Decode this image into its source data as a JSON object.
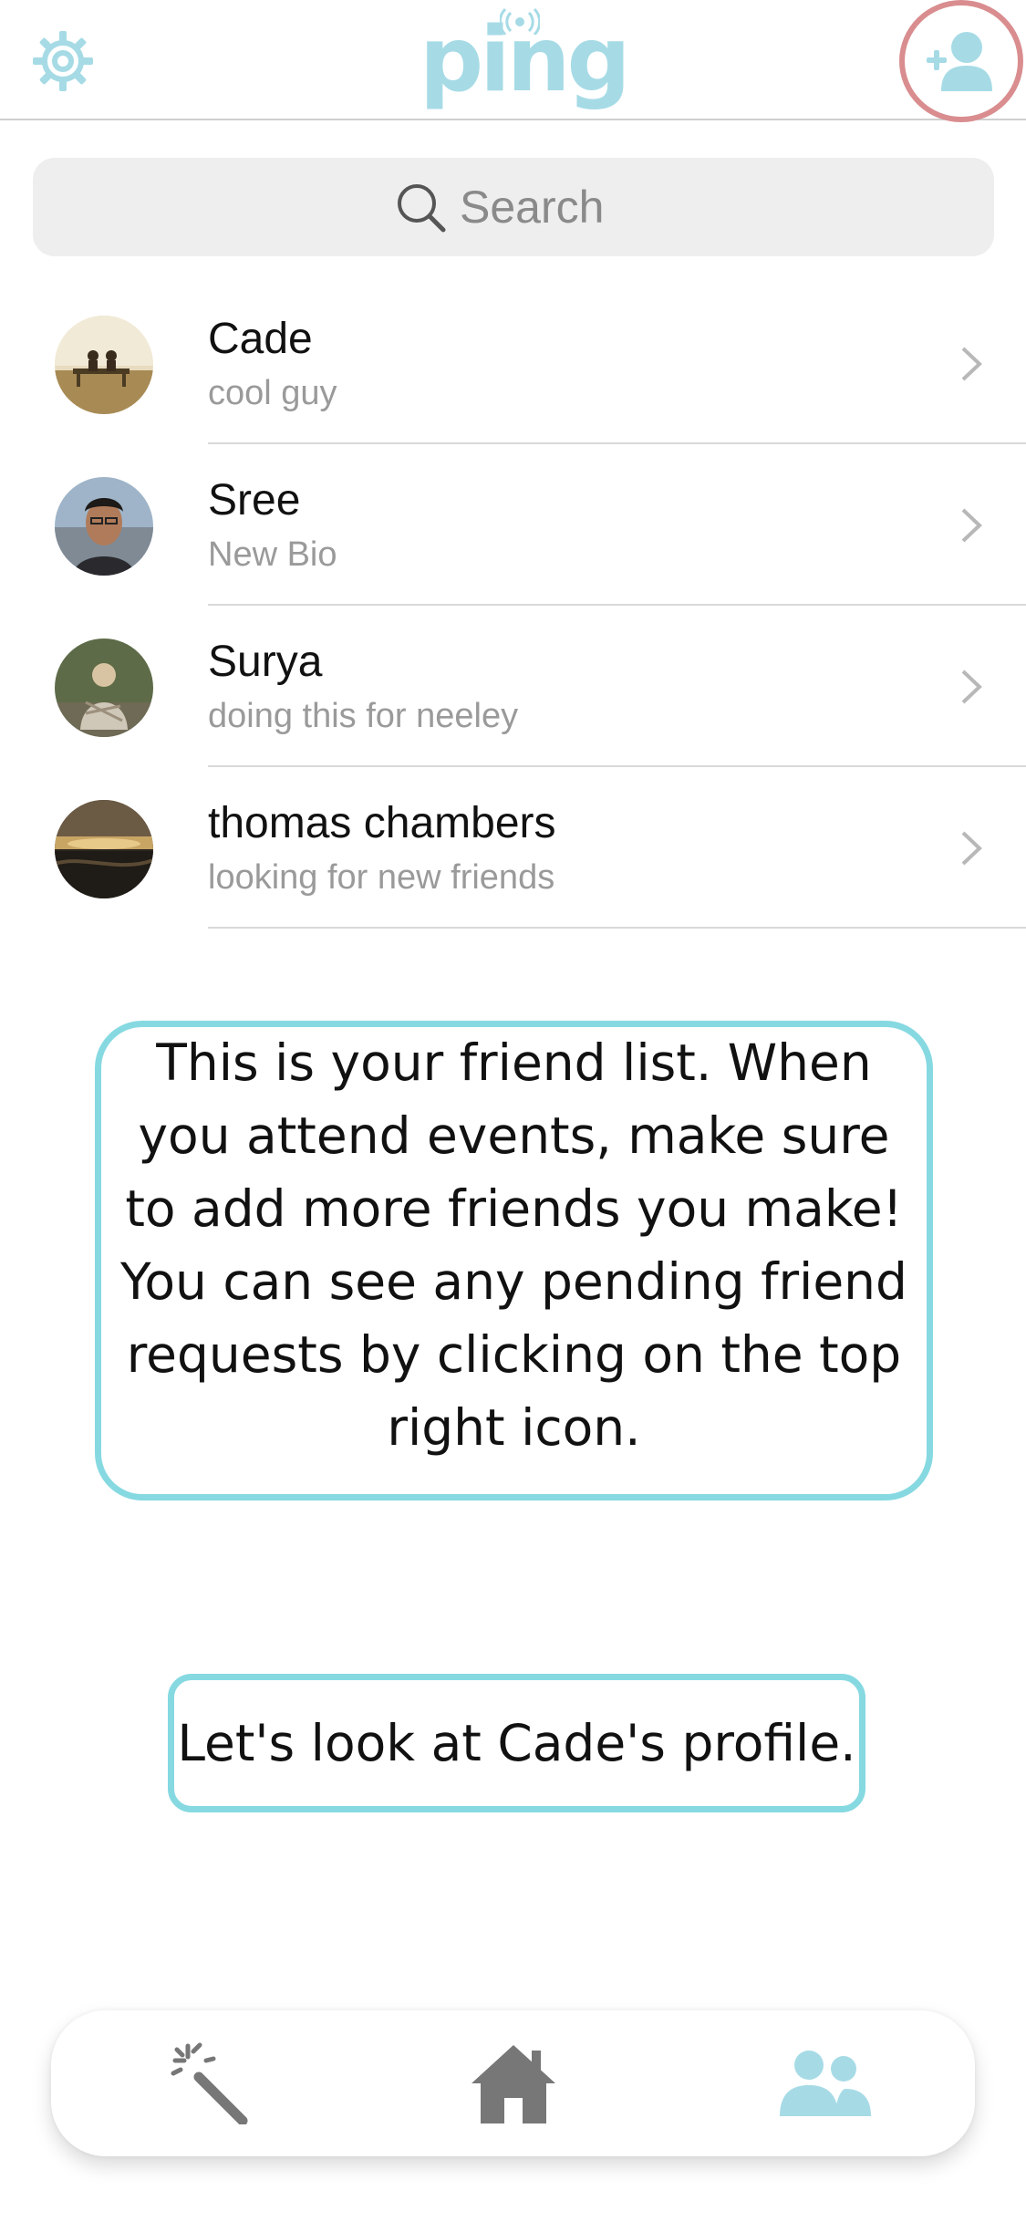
{
  "app": {
    "logo_text": "ping",
    "accent_color": "#a6dbe6",
    "highlight_color": "#d98d8f"
  },
  "header": {
    "settings_icon": "gear-icon",
    "add_friend_icon": "user-plus-icon"
  },
  "search": {
    "placeholder": "Search",
    "value": ""
  },
  "friends": [
    {
      "name": "Cade",
      "bio": "cool guy"
    },
    {
      "name": "Sree",
      "bio": "New Bio"
    },
    {
      "name": "Surya",
      "bio": "doing this for neeley"
    },
    {
      "name": "thomas chambers",
      "bio": "looking for new friends"
    }
  ],
  "tutorial": {
    "tip": "This is your friend list. When you attend events, make sure to add more friends you make! You can see any pending friend requests by clicking on the top right icon.",
    "cta": "Let's look at Cade's profile."
  },
  "nav": {
    "items": [
      {
        "icon": "magic-wand-icon",
        "active": false
      },
      {
        "icon": "home-icon",
        "active": false
      },
      {
        "icon": "friends-icon",
        "active": true
      }
    ]
  }
}
